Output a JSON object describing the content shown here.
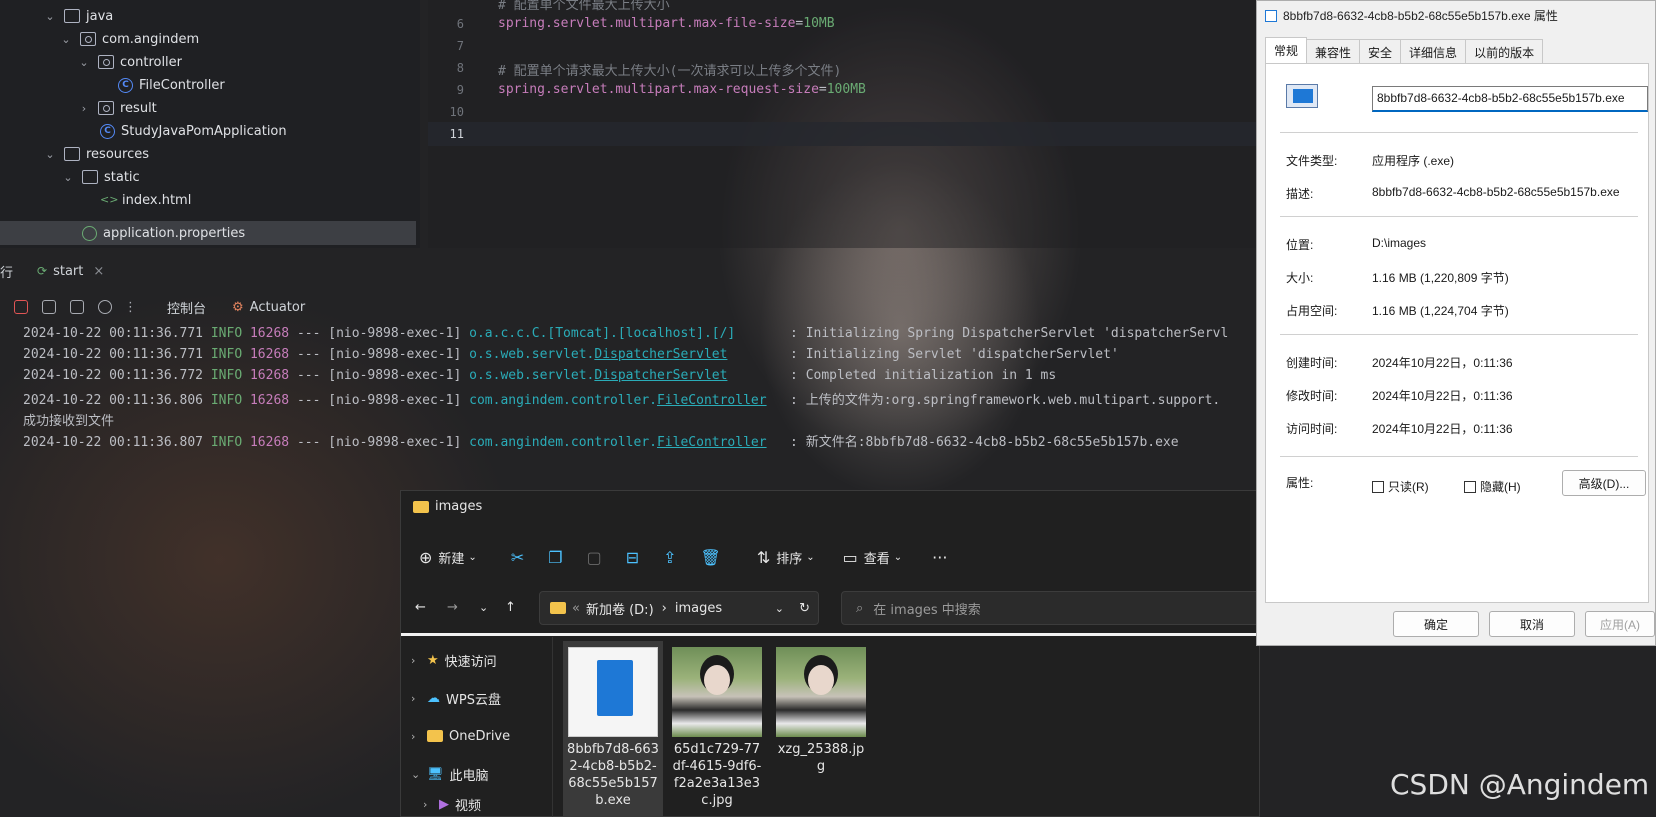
{
  "tree": {
    "items": [
      {
        "label": "java"
      },
      {
        "label": "com.angindem"
      },
      {
        "label": "controller"
      },
      {
        "label": "FileController"
      },
      {
        "label": "result"
      },
      {
        "label": "StudyJavaPomApplication"
      },
      {
        "label": "resources"
      },
      {
        "label": "static"
      },
      {
        "label": "index.html"
      },
      {
        "label": "application.properties"
      }
    ]
  },
  "editor": {
    "line_numbers": [
      "6",
      "7",
      "8",
      "9",
      "10",
      "11"
    ],
    "comment1": "# 配置单个文件最大上传大小",
    "line6_key": "spring.servlet.multipart.max-file-size",
    "line6_val": "10MB",
    "comment2": "# 配置单个请求最大上传大小(一次请求可以上传多个文件)",
    "line9_key": "spring.servlet.multipart.max-request-size",
    "line9_val": "100MB",
    "eq": "="
  },
  "run": {
    "side_label": "行",
    "tab_label": "start",
    "close": "×",
    "console_tab": "控制台",
    "actuator_tab": "Actuator"
  },
  "console": {
    "lines": [
      {
        "ts": "2024-10-22 00:11:36.771",
        "lvl": "INFO",
        "pid": "16268",
        "thread": " --- [nio-9898-exec-1] ",
        "cls": "o.a.c.c.C.[Tomcat].[localhost].[/]",
        "cls_u": "",
        "msg": "       : Initializing Spring DispatcherServlet 'dispatcherServl"
      },
      {
        "ts": "2024-10-22 00:11:36.771",
        "lvl": "INFO",
        "pid": "16268",
        "thread": " --- [nio-9898-exec-1] ",
        "cls": "o.s.web.servlet.",
        "cls_u": "DispatcherServlet",
        "msg": "        : Initializing Servlet 'dispatcherServlet'"
      },
      {
        "ts": "2024-10-22 00:11:36.772",
        "lvl": "INFO",
        "pid": "16268",
        "thread": " --- [nio-9898-exec-1] ",
        "cls": "o.s.web.servlet.",
        "cls_u": "DispatcherServlet",
        "msg": "        : Completed initialization in 1 ms"
      },
      {
        "ts": "2024-10-22 00:11:36.806",
        "lvl": "INFO",
        "pid": "16268",
        "thread": " --- [nio-9898-exec-1] ",
        "cls": "com.angindem.controller.",
        "cls_u": "FileController",
        "msg": "   : 上传的文件为:org.springframework.web.multipart.support."
      },
      {
        "plain": "成功接收到文件"
      },
      {
        "ts": "2024-10-22 00:11:36.807",
        "lvl": "INFO",
        "pid": "16268",
        "thread": " --- [nio-9898-exec-1] ",
        "cls": "com.angindem.controller.",
        "cls_u": "FileController",
        "msg": "   : 新文件名:8bbfb7d8-6632-4cb8-b5b2-68c55e5b157b.exe"
      }
    ]
  },
  "explorer": {
    "title": "images",
    "new_label": "新建",
    "sort_label": "排序",
    "view_label": "查看",
    "more": "···",
    "breadcrumb_drive": "新加卷 (D:)",
    "breadcrumb_sep": "›",
    "breadcrumb_folder": "images",
    "search_placeholder": "在 images 中搜索",
    "nav": [
      {
        "label": "快速访问"
      },
      {
        "label": "WPS云盘"
      },
      {
        "label": "OneDrive"
      },
      {
        "label": "此电脑"
      },
      {
        "label": "视频"
      }
    ],
    "files": [
      {
        "name": "8bbfb7d8-6632-4cb8-b5b2-68c55e5b157b.exe"
      },
      {
        "name": "65d1c729-77df-4615-9df6-f2a2e3a13e3c.jpg"
      },
      {
        "name": "xzg_25388.jpg"
      }
    ]
  },
  "props": {
    "title": "8bbfb7d8-6632-4cb8-b5b2-68c55e5b157b.exe 属性",
    "tabs": [
      "常规",
      "兼容性",
      "安全",
      "详细信息",
      "以前的版本"
    ],
    "filename": "8bbfb7d8-6632-4cb8-b5b2-68c55e5b157b.exe",
    "rows": [
      {
        "label": "文件类型:",
        "value": "应用程序 (.exe)"
      },
      {
        "label": "描述:",
        "value": "8bbfb7d8-6632-4cb8-b5b2-68c55e5b157b.exe"
      },
      {
        "label": "位置:",
        "value": "D:\\images"
      },
      {
        "label": "大小:",
        "value": "1.16 MB (1,220,809 字节)"
      },
      {
        "label": "占用空间:",
        "value": "1.16 MB (1,224,704 字节)"
      },
      {
        "label": "创建时间:",
        "value": "2024年10月22日，0:11:36"
      },
      {
        "label": "修改时间:",
        "value": "2024年10月22日，0:11:36"
      },
      {
        "label": "访问时间:",
        "value": "2024年10月22日，0:11:36"
      }
    ],
    "attr_label": "属性:",
    "readonly_label": "只读(R)",
    "hidden_label": "隐藏(H)",
    "advanced_label": "高级(D)...",
    "ok_label": "确定",
    "cancel_label": "取消",
    "apply_label": "应用(A)"
  },
  "watermark": "CSDN @Angindem"
}
